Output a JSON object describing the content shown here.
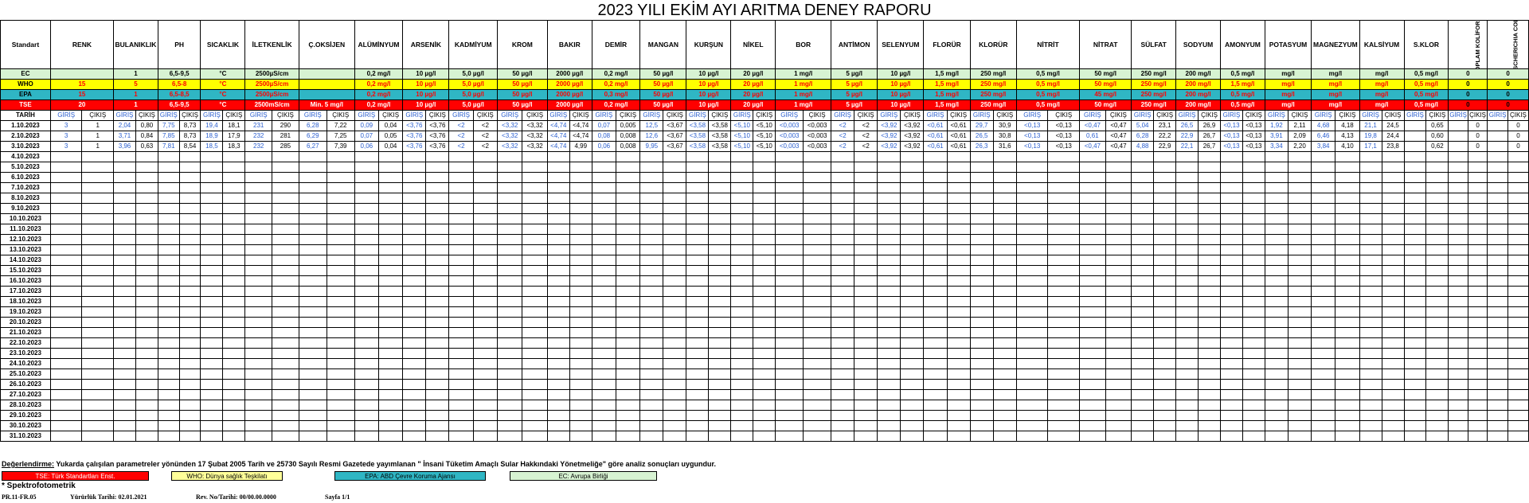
{
  "title": "2023 YILI EKİM AYI ARITMA DENEY RAPORU",
  "header": {
    "standart": "Standart",
    "simple": [
      "RENK",
      "BULANIKLIK",
      "PH",
      "SICAKLIK",
      "İLETKENLİK",
      "Ç.OKSİJEN",
      "ALÜMİNYUM",
      "ARSENİK",
      "KADMİYUM",
      "KROM",
      "BAKIR",
      "DEMİR",
      "MANGAN",
      "KURŞUN",
      "NİKEL",
      "BOR",
      "ANTİMON",
      "SELENYUM",
      "FLORÜR",
      "KLORÜR",
      "NİTRİT",
      "NİTRAT",
      "SÜLFAT",
      "SODYUM",
      "AMONYUM",
      "POTASYUM",
      "MAGNEZYUM",
      "KALSİYUM",
      "S.KLOR"
    ],
    "rotated": [
      "TOPLAM KOLİFORM",
      "ESCHERICHIA COLİ"
    ]
  },
  "standards": [
    {
      "label": "EC",
      "values": [
        "",
        "1",
        "6,5-9,5",
        "°C",
        "2500µS/cm",
        "",
        "0,2 mg/l",
        "10 µg/l",
        "5,0 µg/l",
        "50 µg/l",
        "2000 µg/l",
        "0,2 mg/l",
        "50 µg/l",
        "10 µg/l",
        "20 µg/l",
        "1 mg/l",
        "5 µg/l",
        "10 µg/l",
        "1,5 mg/l",
        "250 mg/l",
        "0,5 mg/l",
        "50 mg/l",
        "250 mg/l",
        "200 mg/l",
        "0,5 mg/l",
        "mg/l",
        "mg/l",
        "mg/l",
        "0,5 mg/l",
        "0",
        "0"
      ]
    },
    {
      "label": "WHO",
      "values": [
        "15",
        "5",
        "6,5-8",
        "°C",
        "2500µS/cm",
        "",
        "0,2 mg/l",
        "10 µg/l",
        "5,0 µg/l",
        "50 µg/l",
        "2000 µg/l",
        "0,2 mg/l",
        "50 µg/l",
        "10 µg/l",
        "20 µg/l",
        "1 mg/l",
        "5 µg/l",
        "10 µg/l",
        "1,5 mg/l",
        "250 mg/l",
        "0,5 mg/l",
        "50 mg/l",
        "250 mg/l",
        "200 mg/l",
        "1,5 mg/l",
        "mg/l",
        "mg/l",
        "mg/l",
        "0,5 mg/l",
        "0",
        "0"
      ]
    },
    {
      "label": "EPA",
      "values": [
        "15",
        "1",
        "6,5-8,5",
        "°C",
        "2500µS/cm",
        "",
        "0,2 mg/l",
        "10 µg/l",
        "5,0 µg/l",
        "50 µg/l",
        "2000 µg/l",
        "0,3 mg/l",
        "50 µg/l",
        "10 µg/l",
        "20 µg/l",
        "1 mg/l",
        "5 µg/l",
        "10 µg/l",
        "1,5 mg/l",
        "250 mg/l",
        "0,5 mg/l",
        "45 mg/l",
        "250 mg/l",
        "200 mg/l",
        "0,5 mg/l",
        "mg/l",
        "mg/l",
        "mg/l",
        "0,5 mg/l",
        "0",
        "0"
      ]
    },
    {
      "label": "TSE",
      "values": [
        "20",
        "1",
        "6,5-9,5",
        "°C",
        "2500mS/cm",
        "Min. 5 mg/l",
        "0,2 mg/l",
        "10 µg/l",
        "5,0 µg/l",
        "50 µg/l",
        "2000 µg/l",
        "0,2 mg/l",
        "50 µg/l",
        "10 µg/l",
        "20 µg/l",
        "1 mg/l",
        "5 µg/l",
        "10 µg/l",
        "1,5 mg/l",
        "250 mg/l",
        "0,5 mg/l",
        "50 mg/l",
        "250 mg/l",
        "200 mg/l",
        "0,5 mg/l",
        "mg/l",
        "mg/l",
        "mg/l",
        "0,5 mg/l",
        "0",
        "0"
      ]
    }
  ],
  "subheader": {
    "tarih": "TARİH",
    "giris": "GİRİŞ",
    "cikis": "ÇIKIŞ"
  },
  "rows": [
    {
      "date": "1.10.2023",
      "values": [
        "3",
        "1",
        "2,04",
        "0,80",
        "7,75",
        "8,73",
        "19,4",
        "18,1",
        "231",
        "290",
        "6,28",
        "7,22",
        "0,09",
        "0,04",
        "<3,76",
        "<3,76",
        "<2",
        "<2",
        "<3,32",
        "<3,32",
        "<4,74",
        "<4,74",
        "0,07",
        "0,005",
        "12,5",
        "<3,67",
        "<3,58",
        "<3,58",
        "<5,10",
        "<5,10",
        "<0,003",
        "<0,003",
        "<2",
        "<2",
        "<3,92",
        "<3,92",
        "<0,61",
        "<0,61",
        "29,7",
        "30,9",
        "<0,13",
        "<0,13",
        "<0,47",
        "<0,47",
        "5,04",
        "23,1",
        "26,5",
        "26,9",
        "<0,13",
        "<0,13",
        "1,92",
        "2,11",
        "4,68",
        "4,18",
        "21,1",
        "24,5",
        "",
        "0,65",
        "",
        "0",
        "",
        "0"
      ]
    },
    {
      "date": "2.10.2023",
      "values": [
        "3",
        "1",
        "3,71",
        "0,84",
        "7,85",
        "8,73",
        "18,9",
        "17,9",
        "232",
        "281",
        "6,29",
        "7,25",
        "0,07",
        "0,05",
        "<3,76",
        "<3,76",
        "<2",
        "<2",
        "<3,32",
        "<3,32",
        "<4,74",
        "<4,74",
        "0,08",
        "0,008",
        "12,6",
        "<3,67",
        "<3,58",
        "<3,58",
        "<5,10",
        "<5,10",
        "<0,003",
        "<0,003",
        "<2",
        "<2",
        "<3,92",
        "<3,92",
        "<0,61",
        "<0,61",
        "26,5",
        "30,8",
        "<0,13",
        "<0,13",
        "0,61",
        "<0,47",
        "6,28",
        "22,2",
        "22,9",
        "26,7",
        "<0,13",
        "<0,13",
        "3,91",
        "2,09",
        "6,46",
        "4,13",
        "19,8",
        "24,4",
        "",
        "0,60",
        "",
        "0",
        "",
        "0"
      ]
    },
    {
      "date": "3.10.2023",
      "values": [
        "3",
        "1",
        "3,96",
        "0,63",
        "7,81",
        "8,54",
        "18,5",
        "18,3",
        "232",
        "285",
        "6,27",
        "7,39",
        "0,06",
        "0,04",
        "<3,76",
        "<3,76",
        "<2",
        "<2",
        "<3,32",
        "<3,32",
        "<4,74",
        "4,99",
        "0,06",
        "0,008",
        "9,95",
        "<3,67",
        "<3,58",
        "<3,58",
        "<5,10",
        "<5,10",
        "<0,003",
        "<0,003",
        "<2",
        "<2",
        "<3,92",
        "<3,92",
        "<0,61",
        "<0,61",
        "26,3",
        "31,6",
        "<0,13",
        "<0,13",
        "<0,47",
        "<0,47",
        "4,88",
        "22,9",
        "22,1",
        "26,7",
        "<0,13",
        "<0,13",
        "3,34",
        "2,20",
        "3,84",
        "4,10",
        "17,1",
        "23,8",
        "",
        "0,62",
        "",
        "0",
        "",
        "0"
      ]
    }
  ],
  "empty_dates": [
    "4.10.2023",
    "5.10.2023",
    "6.10.2023",
    "7.10.2023",
    "8.10.2023",
    "9.10.2023",
    "10.10.2023",
    "11.10.2023",
    "12.10.2023",
    "13.10.2023",
    "14.10.2023",
    "15.10.2023",
    "16.10.2023",
    "17.10.2023",
    "18.10.2023",
    "19.10.2023",
    "20.10.2023",
    "21.10.2023",
    "22.10.2023",
    "23.10.2023",
    "24.10.2023",
    "25.10.2023",
    "26.10.2023",
    "27.10.2023",
    "28.10.2023",
    "29.10.2023",
    "30.10.2023",
    "31.10.2023"
  ],
  "footer": {
    "note_label": "Değerlendirme:",
    "note_text": " Yukarda çalışılan parametreler yönünden 17 Şubat 2005 Tarih ve 25730 Sayılı Resmi Gazetede yayımlanan \" İnsani Tüketim Amaçlı Sular Hakkındaki Yönetmeliğe\" göre analiz sonuçları uygundur.",
    "legend": [
      {
        "label": "TSE: Türk Standartları Enst.",
        "color": "#ff0000",
        "text_color": "#ffffff"
      },
      {
        "label": "WHO: Dünya sağlık Teşkilatı",
        "color": "#ffff99",
        "text_color": "#000000"
      },
      {
        "label": "EPA: ABD Çevre Koruma Ajansı",
        "color": "#2fb6c4",
        "text_color": "#000000"
      },
      {
        "label": "EC: Avrupa  Birliği",
        "color": "#d7f3d2",
        "text_color": "#000000"
      }
    ],
    "spektro": "* Spektrofotometrik",
    "doc_no": "PR.11-FR.05",
    "yururluk": "Yürürlük Tarihi: 02.01.2021",
    "rev": "Rev. No/Tarihi: 00/00.00.0000",
    "sayfa": "Sayfa 1/1"
  }
}
